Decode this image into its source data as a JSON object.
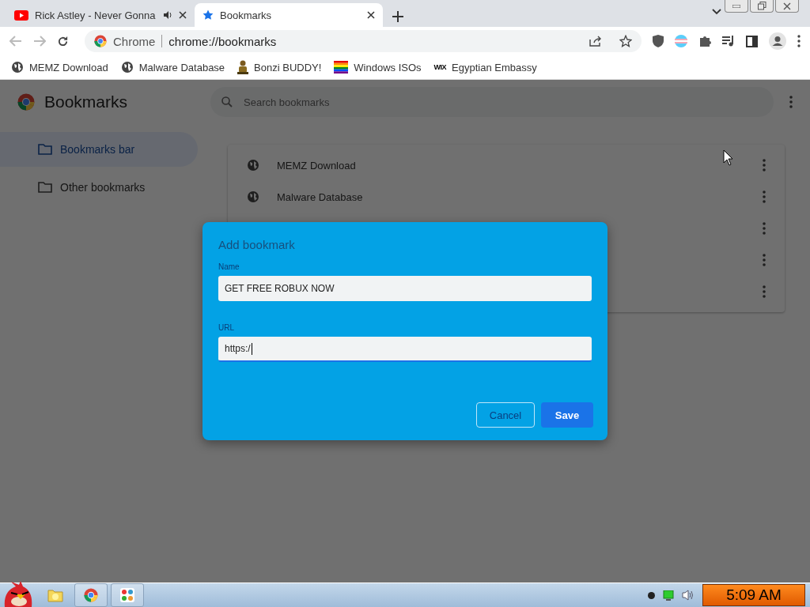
{
  "tabs": [
    {
      "title": "Rick Astley - Never Gonna",
      "selected": false,
      "audio": true
    },
    {
      "title": "Bookmarks",
      "selected": true,
      "audio": false
    }
  ],
  "omnibox": {
    "chip": "Chrome",
    "url": "chrome://bookmarks"
  },
  "bookmarks_bar": [
    {
      "label": "MEMZ Download"
    },
    {
      "label": "Malware Database"
    },
    {
      "label": "Bonzi BUDDY!"
    },
    {
      "label": "Windows ISOs"
    },
    {
      "label": "Egyptian Embassy",
      "logo_text": "WIX"
    }
  ],
  "manager": {
    "title": "Bookmarks",
    "search": {
      "placeholder": "Search bookmarks"
    },
    "folders": [
      {
        "label": "Bookmarks bar",
        "selected": true
      },
      {
        "label": "Other bookmarks",
        "selected": false
      }
    ],
    "rows": [
      {
        "kind": "bookmark",
        "title": "MEMZ Download"
      },
      {
        "kind": "bookmark",
        "title": "Malware Database"
      },
      {
        "kind": "covered"
      },
      {
        "kind": "covered"
      },
      {
        "kind": "covered"
      }
    ]
  },
  "dialog": {
    "title": "Add bookmark",
    "fields": [
      {
        "label": "Name",
        "value": "GET FREE ROBUX NOW",
        "focused": false
      },
      {
        "label": "URL",
        "value": "https:/",
        "focused": true
      }
    ],
    "buttons": [
      {
        "label": "Cancel",
        "kind": "secondary"
      },
      {
        "label": "Save",
        "kind": "primary"
      }
    ]
  },
  "taskbar": {
    "clock": "5:09 AM"
  }
}
